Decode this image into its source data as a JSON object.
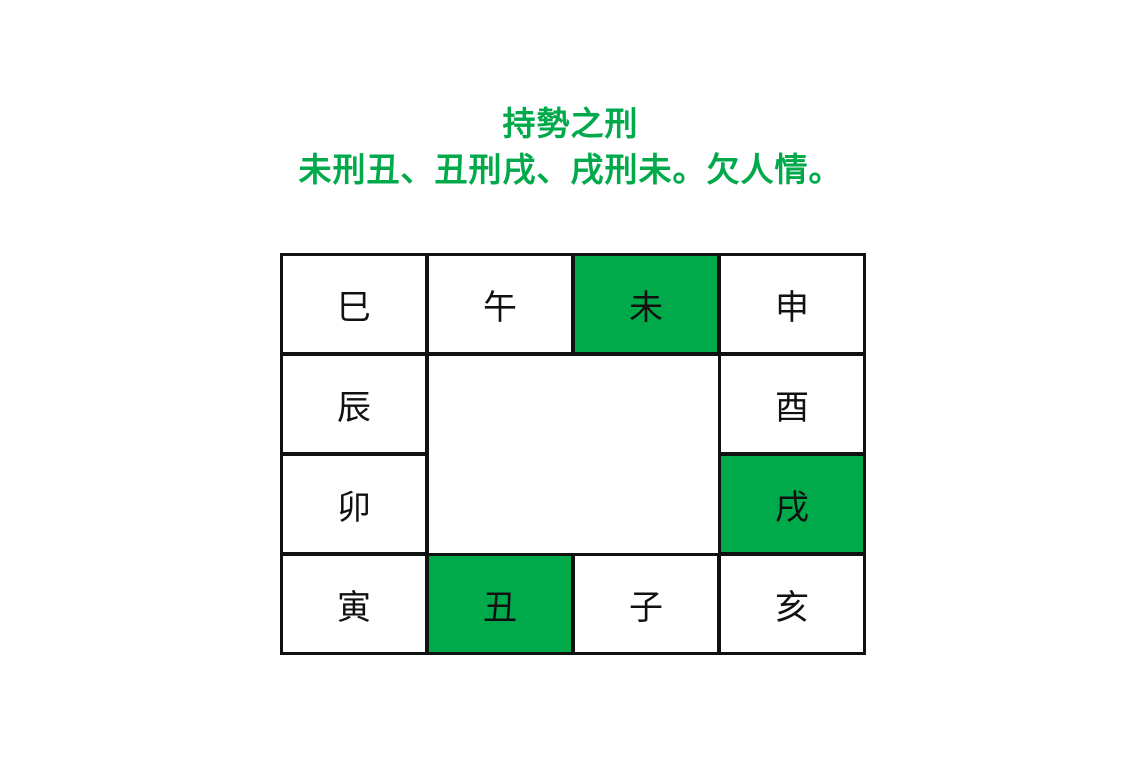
{
  "title": {
    "line1": "持勢之刑",
    "line2": "未刑丑、丑刑戌、戌刑未。欠人情。"
  },
  "colors": {
    "accent": "#00AA4B",
    "border": "#111111",
    "text": "#111111",
    "background": "#FFFFFF"
  },
  "branches": [
    {
      "label": "巳",
      "row": 0,
      "col": 0,
      "highlighted": false
    },
    {
      "label": "午",
      "row": 0,
      "col": 1,
      "highlighted": false
    },
    {
      "label": "未",
      "row": 0,
      "col": 2,
      "highlighted": true
    },
    {
      "label": "申",
      "row": 0,
      "col": 3,
      "highlighted": false
    },
    {
      "label": "辰",
      "row": 1,
      "col": 0,
      "highlighted": false
    },
    {
      "label": "酉",
      "row": 1,
      "col": 3,
      "highlighted": false
    },
    {
      "label": "卯",
      "row": 2,
      "col": 0,
      "highlighted": false
    },
    {
      "label": "戌",
      "row": 2,
      "col": 3,
      "highlighted": true
    },
    {
      "label": "寅",
      "row": 3,
      "col": 0,
      "highlighted": false
    },
    {
      "label": "丑",
      "row": 3,
      "col": 1,
      "highlighted": true
    },
    {
      "label": "子",
      "row": 3,
      "col": 2,
      "highlighted": false
    },
    {
      "label": "亥",
      "row": 3,
      "col": 3,
      "highlighted": false
    }
  ]
}
